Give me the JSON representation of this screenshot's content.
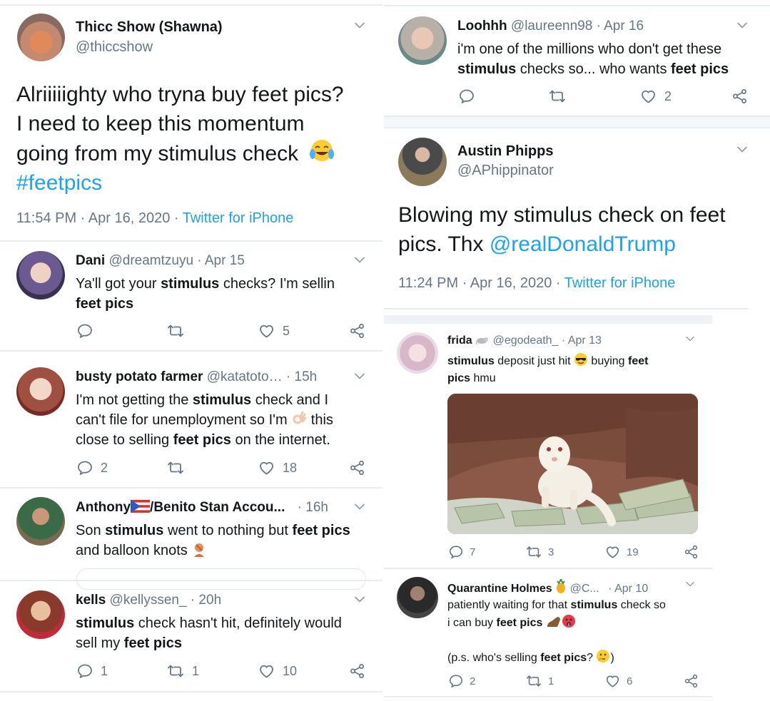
{
  "left": {
    "main_tweet": {
      "name": "Thicc Show (Shawna)",
      "handle": "@thiccshow",
      "text_1": "Alriiiiighty who tryna buy feet pics?",
      "text_2": "I need to keep this momentum",
      "text_3": "going from my stimulus check",
      "hashtag": "#feetpics",
      "time": "11:54 PM · Apr 16, 2020 · ",
      "source": "Twitter for iPhone"
    },
    "replies": [
      {
        "name": "Dani",
        "handle": "@dreamtzuyu · Apr 15",
        "line1_a": "Ya'll got your ",
        "line1_b": "stimulus",
        "line1_c": " checks? I'm sellin",
        "line2_b": "feet pics",
        "likes": "5"
      },
      {
        "name": "busty potato farmer",
        "handle": "@katatoto…",
        "time": "· 15h",
        "line1_a": "I'm not getting the ",
        "line1_b": "stimulus",
        "line1_c": " check and I",
        "line2": "can't file for unemployment so I'm",
        "line2_c": " this",
        "line3_a": "close to selling ",
        "line3_b": "feet pics",
        "line3_c": " on the internet.",
        "replies": "2",
        "likes": "18"
      },
      {
        "name_a": "Anthony",
        "name_b": "/Benito Stan Accou...",
        "time": "· 16h",
        "line1_a": "Son ",
        "line1_b": "stimulus",
        "line1_c": " went to nothing but ",
        "line1_d": "feet pics",
        "line2": "and balloon knots"
      },
      {
        "name": "kells",
        "handle": "@kellyssen_ · 20h",
        "line1_b": "stimulus",
        "line1_c": " check hasn't hit, definitely would",
        "line2_a": "sell my ",
        "line2_b": "feet pics",
        "replies": "1",
        "retweets": "1",
        "likes": "10"
      }
    ]
  },
  "right": {
    "loohhh": {
      "name": "Loohhh",
      "handle": "@laureenn98 · Apr 16",
      "line1": "i'm one of the millions who don't get these",
      "line2_b": "stimulus",
      "line2_c": " checks so... who wants ",
      "line2_d": "feet pics",
      "likes": "2"
    },
    "austin": {
      "name": "Austin Phipps",
      "handle": "@APhippinator",
      "line1": "Blowing my stimulus check on feet",
      "line2_a": "pics. Thx ",
      "mention": "@realDonaldTrump",
      "time": "11:24 PM · Apr 16, 2020 · ",
      "source": "Twitter for iPhone"
    },
    "frida": {
      "name": "frida",
      "handle": "@egodeath_ · Apr 13",
      "line1_b": "stimulus",
      "line1_c": " deposit just hit ",
      "line1_d": " buying ",
      "line1_e": "feet",
      "line2_b": "pics",
      "line2_c": " hmu",
      "replies": "7",
      "retweets": "3",
      "likes": "19"
    },
    "quarantine": {
      "name": "Quarantine Holmes",
      "handle": "@C...",
      "time": "· Apr 10",
      "line1_a": "patiently waiting for that ",
      "line1_b": "stimulus",
      "line1_c": " check so",
      "line2_a": "i can buy ",
      "line2_b": "feet pics",
      "line3_a": "(p.s. who's selling ",
      "line3_b": "feet pics",
      "line3_c": "? ",
      "line3_d": ")",
      "replies": "2",
      "retweets": "1",
      "likes": "6"
    }
  },
  "colors": {
    "link": "#1da1f2",
    "meta": "#657786",
    "divider": "#e6ecf0"
  }
}
